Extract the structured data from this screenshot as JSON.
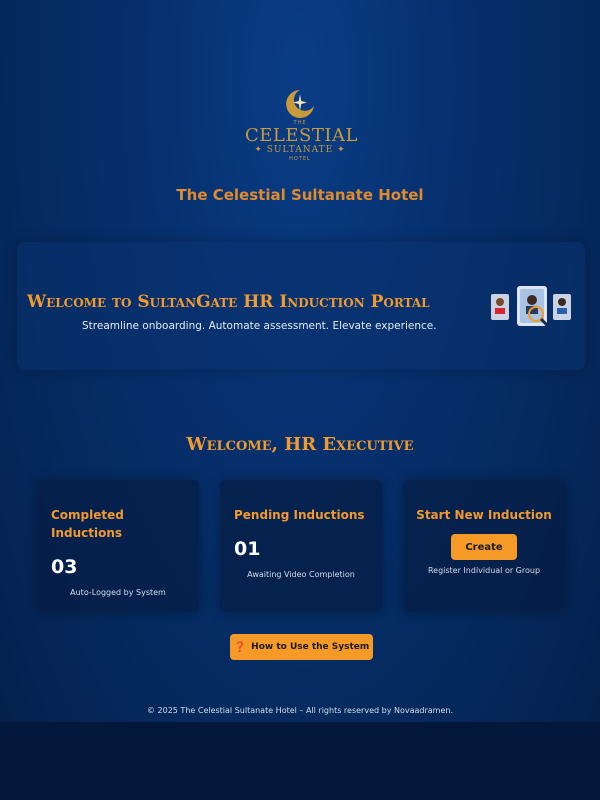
{
  "logo": {
    "line1": "THE",
    "line2": "CELESTIAL",
    "line3": "SULTANATE",
    "line4": "HOTEL",
    "icon": "crescent-moon-star-icon",
    "color": "#c99a3a"
  },
  "header": {
    "hotel_name": "The Celestial Sultanate Hotel"
  },
  "banner": {
    "title": "Welcome to SultanGate HR Induction Portal",
    "subtitle": "Streamline onboarding. Automate assessment. Elevate experience.",
    "illustration": "candidate-review-icon"
  },
  "dashboard": {
    "greeting": "Welcome, HR Executive",
    "cards": [
      {
        "title": "Completed Inductions",
        "count": "03",
        "note": "Auto-Logged by System"
      },
      {
        "title": "Pending Inductions",
        "count": "01",
        "note": "Awaiting Video Completion"
      },
      {
        "title": "Start New Induction",
        "button": "Create",
        "note": "Register Individual or Group"
      }
    ]
  },
  "help": {
    "icon": "question-mark-icon",
    "label": "How to Use the System"
  },
  "footer": {
    "text": "© 2025 The Celestial Sultanate Hotel – All rights reserved by Novaadramen."
  },
  "colors": {
    "accent": "#f29a2e",
    "button": "#f59a26",
    "background": "#06306e"
  }
}
